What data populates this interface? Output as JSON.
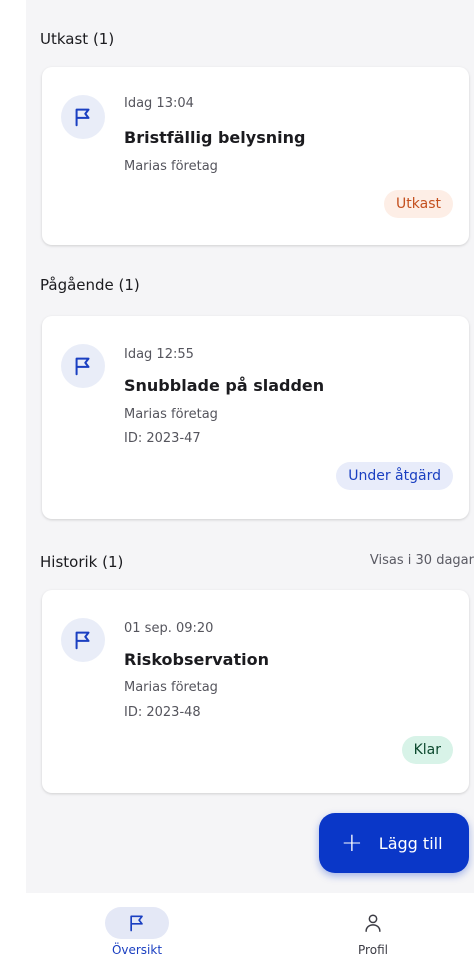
{
  "sections": {
    "drafts": {
      "title": "Utkast (1)",
      "item": {
        "time": "Idag 13:04",
        "title": "Bristfällig belysning",
        "company": "Marias företag",
        "badge": "Utkast",
        "icon": "flag-icon"
      }
    },
    "ongoing": {
      "title": "Pågående (1)",
      "item": {
        "time": "Idag 12:55",
        "title": "Snubblade på sladden",
        "company": "Marias företag",
        "id": "ID: 2023-47",
        "badge": "Under åtgärd",
        "icon": "flag-icon"
      }
    },
    "history": {
      "title": "Historik (1)",
      "note": "Visas i 30 dagar",
      "item": {
        "time": "01 sep. 09:20",
        "title": "Riskobservation",
        "company": "Marias företag",
        "id": "ID: 2023-48",
        "badge": "Klar",
        "icon": "flag-icon"
      }
    }
  },
  "fab": {
    "icon": "plus-icon",
    "label": "Lägg till"
  },
  "bottom_nav": {
    "items": [
      {
        "label": "Översikt",
        "icon": "flag-icon",
        "selected": true
      },
      {
        "label": "Profil",
        "icon": "person-icon",
        "selected": false
      }
    ]
  },
  "colors": {
    "accent": "#0a37c8",
    "draft_badge_bg": "#fdeee6",
    "draft_badge_text": "#c4501f",
    "ongoing_badge_bg": "#e8ecfa",
    "ongoing_badge_text": "#1a3fc1",
    "done_badge_bg": "#d8f3e8",
    "done_badge_text": "#0d4a2f"
  }
}
